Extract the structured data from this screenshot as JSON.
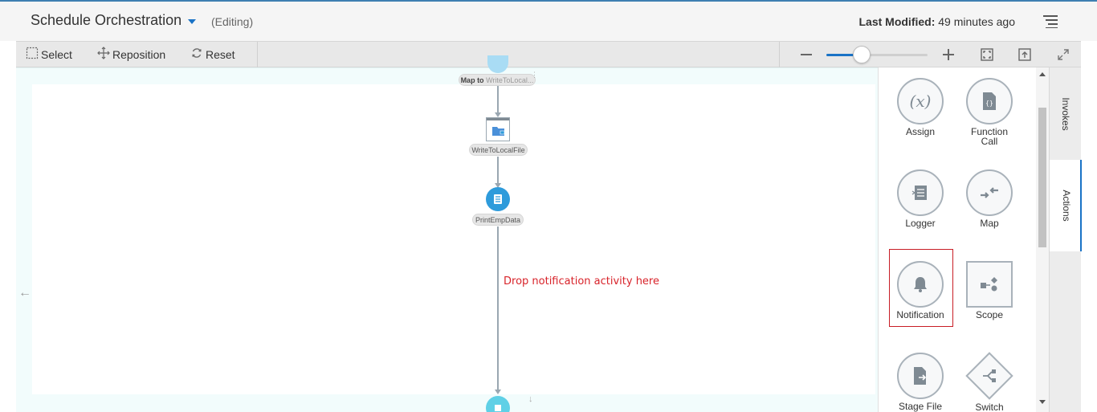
{
  "header": {
    "title": "Schedule Orchestration",
    "editing_label": "(Editing)",
    "last_modified_label": "Last Modified:",
    "last_modified_value": "49 minutes ago"
  },
  "toolbar": {
    "select_label": "Select",
    "reposition_label": "Reposition",
    "reset_label": "Reset",
    "zoom_level": 0.35
  },
  "canvas": {
    "nodes": {
      "map_node_label": "Map to WriteToLocal...",
      "map_node_prefix": "Map to",
      "map_node_target": "WriteToLocal...",
      "write_node_label": "WriteToLocalFile",
      "print_node_label": "PrintEmpData"
    },
    "drop_hint": "Drop notification activity here"
  },
  "palette": {
    "items": [
      {
        "label": "Assign",
        "icon": "variable-x-icon"
      },
      {
        "label": "Function Call",
        "icon": "function-doc-icon"
      },
      {
        "label": "Logger",
        "icon": "logger-icon"
      },
      {
        "label": "Map",
        "icon": "map-arrows-icon"
      },
      {
        "label": "Notification",
        "icon": "bell-icon"
      },
      {
        "label": "Scope",
        "icon": "scope-icon"
      },
      {
        "label": "Stage File",
        "icon": "stage-file-icon"
      },
      {
        "label": "Switch",
        "icon": "switch-icon"
      }
    ]
  },
  "side_tabs": {
    "invokes": "Invokes",
    "actions": "Actions"
  },
  "colors": {
    "accent": "#1a73c6",
    "node_blue": "#2e9bdb",
    "drop_hint": "#d8232a",
    "highlight_border": "#c81d25"
  }
}
